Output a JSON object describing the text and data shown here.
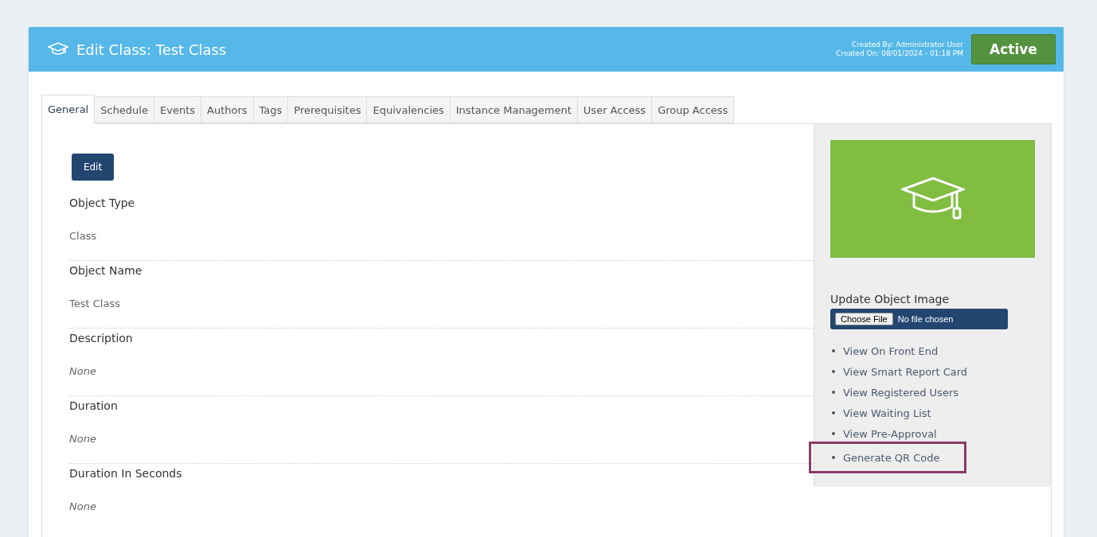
{
  "header": {
    "title": "Edit Class: Test Class",
    "created_by": "Created By: Administrator User",
    "created_on": "Created On: 08/01/2024 - 01:18 PM",
    "status": {
      "label": "Active",
      "kind": "active"
    }
  },
  "tabs": [
    {
      "label": "General",
      "selected": true
    },
    {
      "label": "Schedule",
      "selected": false
    },
    {
      "label": "Events",
      "selected": false
    },
    {
      "label": "Authors",
      "selected": false
    },
    {
      "label": "Tags",
      "selected": false
    },
    {
      "label": "Prerequisites",
      "selected": false
    },
    {
      "label": "Equivalencies",
      "selected": false
    },
    {
      "label": "Instance Management",
      "selected": false
    },
    {
      "label": "User Access",
      "selected": false
    },
    {
      "label": "Group Access",
      "selected": false
    }
  ],
  "edit_button": "Edit",
  "fields": [
    {
      "label": "Object Type",
      "value": "Class",
      "empty": false
    },
    {
      "label": "Object Name",
      "value": "Test Class",
      "empty": false
    },
    {
      "label": "Description",
      "value": "None",
      "empty": true
    },
    {
      "label": "Duration",
      "value": "None",
      "empty": true
    },
    {
      "label": "Duration In Seconds",
      "value": "None",
      "empty": true
    }
  ],
  "sidebar": {
    "image_heading": "Update Object Image",
    "file_button": "Choose File",
    "file_status": "No file chosen",
    "links": [
      {
        "label": "View On Front End",
        "highlighted": false
      },
      {
        "label": "View Smart Report Card",
        "highlighted": false
      },
      {
        "label": "View Registered Users",
        "highlighted": false
      },
      {
        "label": "View Waiting List",
        "highlighted": false
      },
      {
        "label": "View Pre-Approval",
        "highlighted": false
      },
      {
        "label": "Generate QR Code",
        "highlighted": true
      }
    ]
  }
}
